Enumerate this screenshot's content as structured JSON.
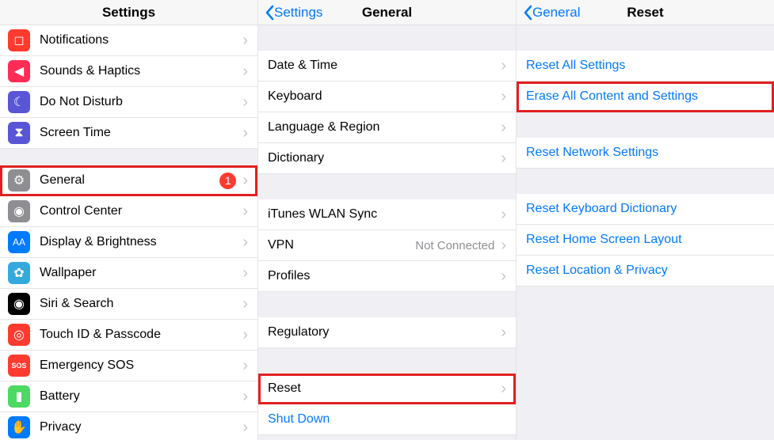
{
  "col1": {
    "title": "Settings",
    "rows": [
      {
        "name": "notifications",
        "label": "Notifications",
        "icon": "bell-icon",
        "color": "ic-red",
        "glyph": "◻"
      },
      {
        "name": "sounds-haptics",
        "label": "Sounds & Haptics",
        "icon": "speaker-icon",
        "color": "ic-redpink",
        "glyph": "◀︎"
      },
      {
        "name": "do-not-disturb",
        "label": "Do Not Disturb",
        "icon": "moon-icon",
        "color": "ic-purple",
        "glyph": "☾"
      },
      {
        "name": "screen-time",
        "label": "Screen Time",
        "icon": "hourglass-icon",
        "color": "ic-purple2",
        "glyph": "⧗"
      },
      {
        "gap": true
      },
      {
        "name": "general",
        "label": "General",
        "icon": "gear-icon",
        "color": "ic-gray",
        "glyph": "⚙",
        "badge": "1",
        "highlight": true
      },
      {
        "name": "control-center",
        "label": "Control Center",
        "icon": "toggles-icon",
        "color": "ic-gray",
        "glyph": "◉"
      },
      {
        "name": "display-brightness",
        "label": "Display & Brightness",
        "icon": "text-size-icon",
        "color": "ic-blue",
        "glyph": "AA"
      },
      {
        "name": "wallpaper",
        "label": "Wallpaper",
        "icon": "flower-icon",
        "color": "ic-cyan",
        "glyph": "✿"
      },
      {
        "name": "siri-search",
        "label": "Siri & Search",
        "icon": "siri-icon",
        "color": "ic-black",
        "glyph": "◉"
      },
      {
        "name": "touch-id",
        "label": "Touch ID & Passcode",
        "icon": "fingerprint-icon",
        "color": "ic-fingerprint",
        "glyph": "◎"
      },
      {
        "name": "emergency-sos",
        "label": "Emergency SOS",
        "icon": "sos-icon",
        "color": "ic-sos",
        "glyph": "SOS"
      },
      {
        "name": "battery",
        "label": "Battery",
        "icon": "battery-icon",
        "color": "ic-green",
        "glyph": "▮"
      },
      {
        "name": "privacy",
        "label": "Privacy",
        "icon": "hand-icon",
        "color": "ic-handblue",
        "glyph": "✋"
      }
    ]
  },
  "col2": {
    "back": "Settings",
    "title": "General",
    "rows": [
      {
        "gap": "lg"
      },
      {
        "name": "date-time",
        "label": "Date & Time"
      },
      {
        "name": "keyboard",
        "label": "Keyboard"
      },
      {
        "name": "language-region",
        "label": "Language & Region"
      },
      {
        "name": "dictionary",
        "label": "Dictionary"
      },
      {
        "gap": "lg"
      },
      {
        "name": "itunes-wlan-sync",
        "label": "iTunes WLAN Sync"
      },
      {
        "name": "vpn",
        "label": "VPN",
        "detail": "Not Connected"
      },
      {
        "name": "profiles",
        "label": "Profiles"
      },
      {
        "gap": "lg"
      },
      {
        "name": "regulatory",
        "label": "Regulatory"
      },
      {
        "gap": "lg"
      },
      {
        "name": "reset",
        "label": "Reset",
        "highlight": true
      },
      {
        "name": "shut-down",
        "label": "Shut Down",
        "blue": true,
        "noChevron": true
      }
    ]
  },
  "col3": {
    "back": "General",
    "title": "Reset",
    "rows": [
      {
        "gap": "lg"
      },
      {
        "name": "reset-all-settings",
        "label": "Reset All Settings",
        "blue": true
      },
      {
        "name": "erase-all",
        "label": "Erase All Content and Settings",
        "blue": true,
        "highlight": true
      },
      {
        "gap": "lg"
      },
      {
        "name": "reset-network",
        "label": "Reset Network Settings",
        "blue": true
      },
      {
        "gap": "lg"
      },
      {
        "name": "reset-keyboard-dict",
        "label": "Reset Keyboard Dictionary",
        "blue": true
      },
      {
        "name": "reset-home-screen",
        "label": "Reset Home Screen Layout",
        "blue": true
      },
      {
        "name": "reset-location-privacy",
        "label": "Reset Location & Privacy",
        "blue": true
      }
    ]
  }
}
